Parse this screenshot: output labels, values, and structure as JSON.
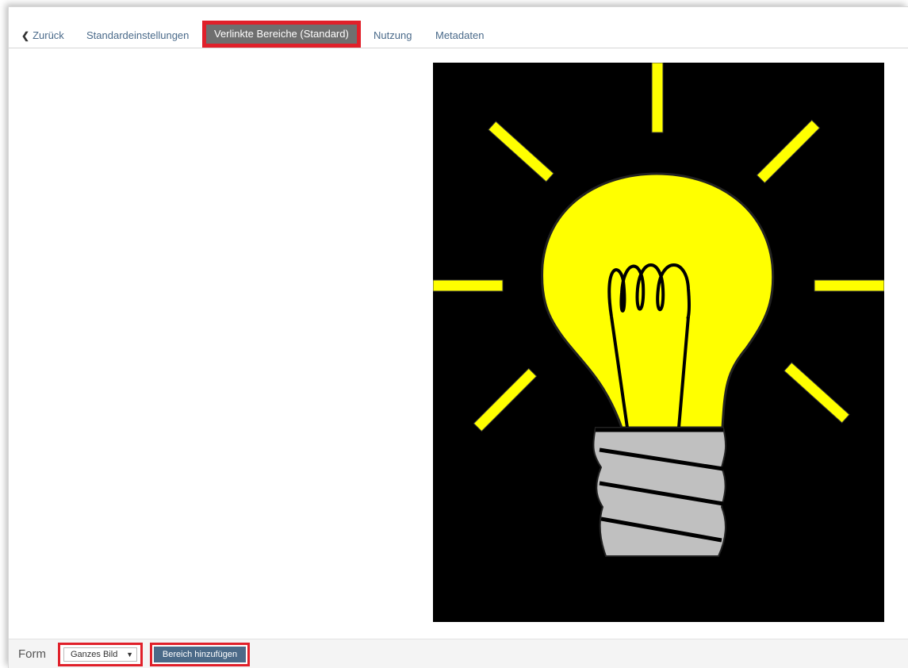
{
  "tabs": {
    "back_label": "Zurück",
    "items": [
      {
        "label": "Standardeinstellungen"
      },
      {
        "label": "Verlinkte Bereiche (Standard)"
      },
      {
        "label": "Nutzung"
      },
      {
        "label": "Metadaten"
      }
    ],
    "active_index": 1
  },
  "image": {
    "icon": "lightbulb-icon"
  },
  "footer": {
    "form_label": "Form",
    "shape_select_value": "Ganzes Bild",
    "add_area_button": "Bereich hinzufügen"
  },
  "colors": {
    "highlight": "#e0202a",
    "active_tab_bg": "#6f6f6f",
    "button_bg": "#4b6a88",
    "bulb_yellow": "#ffff00",
    "base_gray": "#c0c0c0"
  }
}
